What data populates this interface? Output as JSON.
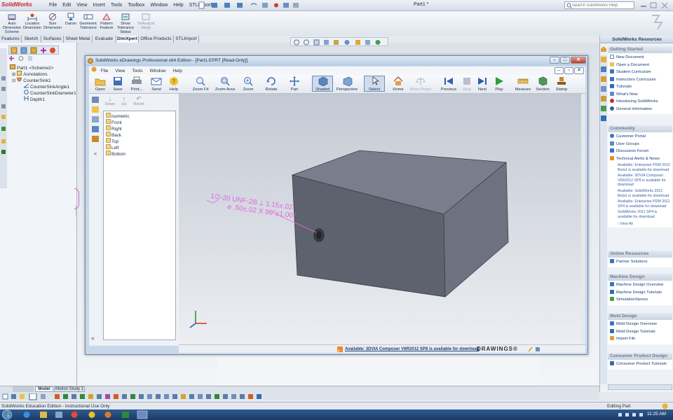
{
  "app": {
    "logo": "SolidWorks",
    "doc_title": "Part1 *"
  },
  "menu": [
    "File",
    "Edit",
    "View",
    "Insert",
    "Tools",
    "Toolbox",
    "Window",
    "Help",
    "STLImport"
  ],
  "search": {
    "placeholder": "Search SolidWorks Help"
  },
  "commands": [
    {
      "label": "Auto Dimension Scheme"
    },
    {
      "label": "Location Dimension"
    },
    {
      "label": "Size Dimension"
    },
    {
      "label": "Datum"
    },
    {
      "label": "Geometric Tolerance"
    },
    {
      "label": "Pattern Feature"
    },
    {
      "label": "Show Tolerance Status"
    },
    {
      "label": "TolAnalyst Study"
    }
  ],
  "tabs": [
    "Features",
    "Sketch",
    "Surfaces",
    "Sheet Metal",
    "Evaluate",
    "DimXpert",
    "Office Products",
    "STLImport"
  ],
  "active_tab": "DimXpert",
  "feature_tree": {
    "root": "Part1 <Scheme2>",
    "items": [
      "Annotations",
      "CounterSink1",
      "CounterSinkAngle1",
      "CounterSinkDiameter1",
      "Depth1"
    ]
  },
  "edrawings": {
    "title": "SolidWorks eDrawings Professional x64 Edition - [Part1.EPRT [Read-Only]]",
    "menu": [
      "File",
      "View",
      "Tools",
      "Window",
      "Help"
    ],
    "toolbar": [
      {
        "label": "Open",
        "enabled": true
      },
      {
        "label": "Save",
        "enabled": true
      },
      {
        "label": "Print...",
        "enabled": true
      },
      {
        "label": "Send",
        "enabled": true
      },
      {
        "label": "Help",
        "enabled": true
      },
      {
        "label": "Zoom Fit",
        "enabled": true
      },
      {
        "label": "Zoom Area",
        "enabled": true
      },
      {
        "label": "Zoom",
        "enabled": true
      },
      {
        "label": "Rotate",
        "enabled": true
      },
      {
        "label": "Pan",
        "enabled": true
      },
      {
        "label": "Shaded",
        "enabled": true
      },
      {
        "label": "Perspective",
        "enabled": true
      },
      {
        "label": "Select",
        "enabled": true
      },
      {
        "label": "Home",
        "enabled": true
      },
      {
        "label": "Mass Props",
        "enabled": false
      },
      {
        "label": "Previous",
        "enabled": true
      },
      {
        "label": "Stop",
        "enabled": false
      },
      {
        "label": "Next",
        "enabled": true
      },
      {
        "label": "Play",
        "enabled": true
      },
      {
        "label": "Measure",
        "enabled": true
      },
      {
        "label": "Section",
        "enabled": true
      },
      {
        "label": "Stamp",
        "enabled": true
      }
    ],
    "nav": [
      "Down",
      "Up",
      "Reset"
    ],
    "views": [
      "Isometric",
      "Front",
      "Right",
      "Back",
      "Top",
      "Left",
      "Bottom"
    ],
    "annotation": {
      "line1": "1/2-20 UNF-2B ⟂ 1.15±.02",
      "line2": "⌀ .50±.02 X 90°±1.00°"
    },
    "status_text": "Available: 3DVIA Composer V6R2012 SP8 is available for download",
    "brand": "DRAWINGS®"
  },
  "task_pane": {
    "title": "SolidWorks Resources",
    "getting_started": {
      "header": "Getting Started",
      "items": [
        "New Document",
        "Open a Document",
        "Student Curriculum",
        "Instructors Curriculum",
        "Tutorials",
        "What's New",
        "Introducing SolidWorks",
        "General Information"
      ]
    },
    "community": {
      "header": "Community",
      "items": [
        "Customer Portal",
        "User Groups",
        "Discussion Forum",
        "Technical Alerts & News"
      ],
      "news": [
        "Available: Enterprise PDM 2012 Beta1 is available for download",
        "Available: 3DVIA Composer V6R2012 SP8 is available for download",
        "Available: SolidWorks 2012 Beta1 is available for download",
        "Available: Enterprise PDM 2011 SP4 is available for download",
        "SolidWorks 2011 SP4 is available for download"
      ],
      "view_all": "View All"
    },
    "online": {
      "header": "Online Resources",
      "items": [
        "Partner Solutions"
      ]
    },
    "machine": {
      "header": "Machine Design",
      "items": [
        "Machine Design Overview",
        "Machine Design Tutorials",
        "SimulationXpress"
      ]
    },
    "mold": {
      "header": "Mold Design",
      "items": [
        "Mold Design Overview",
        "Mold Design Tutorials",
        "Import File"
      ]
    },
    "consumer": {
      "header": "Consumer Product Design",
      "items": [
        "Consumer Product Tutorials"
      ]
    }
  },
  "bottom_tabs": [
    "Model",
    "Motion Study 1"
  ],
  "status_bar": {
    "left": "SolidWorks Education Edition - Instructional Use Only",
    "right": "Editing Part"
  },
  "taskbar": {
    "time": "11:25 AM"
  }
}
